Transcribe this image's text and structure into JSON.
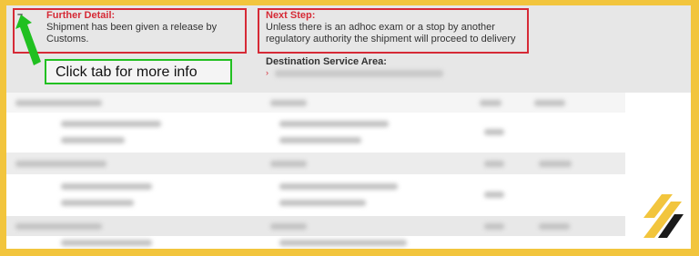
{
  "further_detail": {
    "heading": "Further Detail:",
    "text_line1": "Shipment has been given a release by",
    "text_line2": "Customs."
  },
  "next_step": {
    "heading": "Next Step:",
    "text_line1": "Unless there is an adhoc exam or a stop by another",
    "text_line2": "regulatory authority the shipment will proceed to delivery"
  },
  "destination": {
    "label": "Destination Service Area:",
    "marker": "›"
  },
  "toggle": {
    "symbol": "–"
  },
  "callout": {
    "text": "Click tab for more info"
  },
  "colors": {
    "highlight_red": "#d62a36",
    "callout_green": "#21c021",
    "border_yellow": "#f2c53d"
  }
}
